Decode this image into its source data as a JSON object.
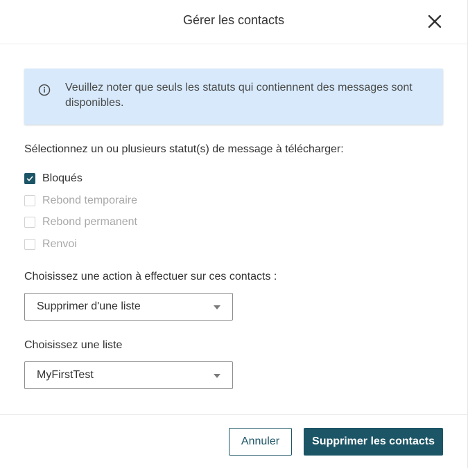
{
  "dialog": {
    "title": "Gérer les contacts"
  },
  "info": {
    "text": "Veuillez noter que seuls les statuts qui contiennent des messages sont disponibles."
  },
  "statuses": {
    "label": "Sélectionnez un ou plusieurs statut(s) de message à télécharger:",
    "items": [
      {
        "label": "Bloqués",
        "checked": true,
        "disabled": false
      },
      {
        "label": "Rebond temporaire",
        "checked": false,
        "disabled": true
      },
      {
        "label": "Rebond permanent",
        "checked": false,
        "disabled": true
      },
      {
        "label": "Renvoi",
        "checked": false,
        "disabled": true
      }
    ]
  },
  "action": {
    "label": "Choisissez une action à effectuer sur ces contacts :",
    "selected": "Supprimer d'une liste"
  },
  "list": {
    "label": "Choisissez une liste",
    "selected": "MyFirstTest"
  },
  "footer": {
    "cancel_label": "Annuler",
    "submit_label": "Supprimer les contacts"
  },
  "colors": {
    "accent": "#1c5566",
    "info_background": "#d7e9fb"
  },
  "icons": {
    "close": "close-icon",
    "info": "info-icon",
    "check": "check-icon",
    "dropdown": "caret-down-icon"
  }
}
